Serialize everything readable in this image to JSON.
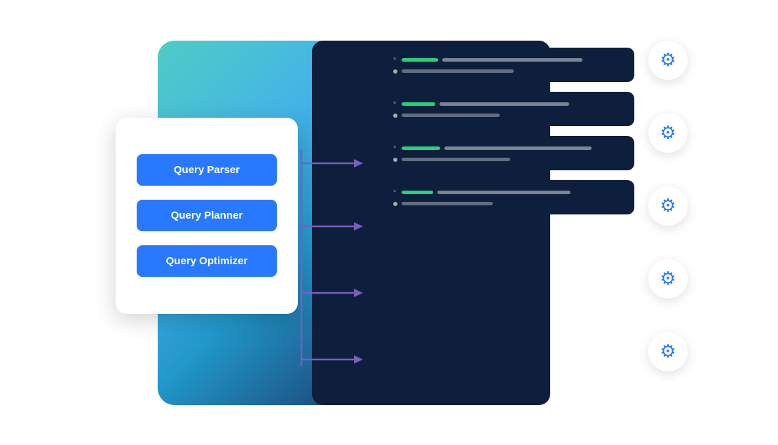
{
  "buttons": [
    {
      "label": "Query Parser"
    },
    {
      "label": "Query Planner"
    },
    {
      "label": "Query Optimizer"
    }
  ],
  "result_rows": [
    {
      "line1_green_width": 52,
      "line1_white_width": 200,
      "line2_white_width": 160
    },
    {
      "line1_green_width": 48,
      "line1_white_width": 185,
      "line2_white_width": 140
    },
    {
      "line1_green_width": 55,
      "line1_white_width": 210,
      "line2_white_width": 155
    },
    {
      "line1_green_width": 45,
      "line1_white_width": 190,
      "line2_white_width": 130
    }
  ],
  "gear_count": 5,
  "colors": {
    "button_bg": "#2979ff",
    "white_card_bg": "#ffffff",
    "dark_panel": "#0d1f3c",
    "gear_color": "#2979ff",
    "arrow_color": "#7c5cbf",
    "green_bar": "#26d07c"
  }
}
